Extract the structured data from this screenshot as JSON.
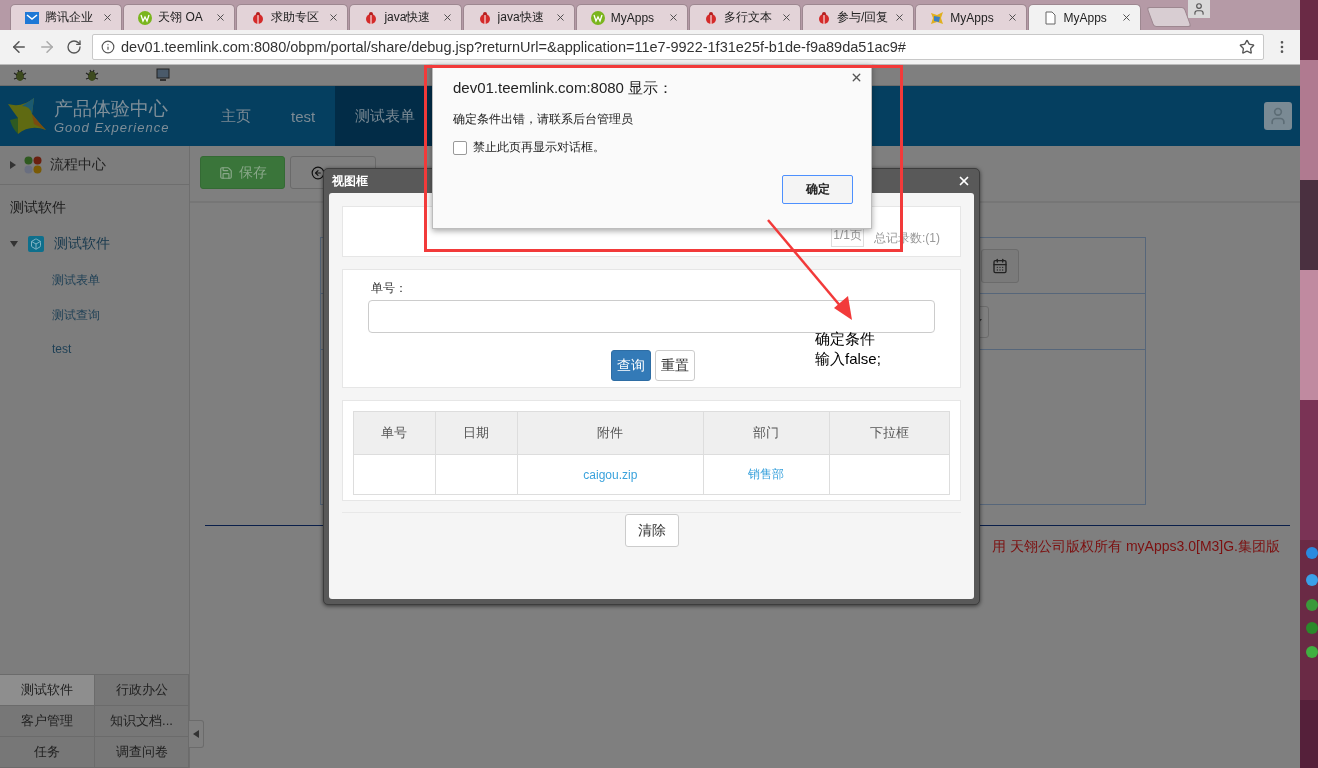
{
  "browser": {
    "tabs": [
      {
        "title": "腾讯企业",
        "kind": "mail",
        "selected": false
      },
      {
        "title": "天翎 OA",
        "kind": "w",
        "selected": false
      },
      {
        "title": "求助专区",
        "kind": "bug",
        "selected": false
      },
      {
        "title": "java快速",
        "kind": "bug",
        "selected": false
      },
      {
        "title": "java快速",
        "kind": "bug",
        "selected": false
      },
      {
        "title": "MyApps",
        "kind": "w",
        "selected": false
      },
      {
        "title": "多行文本",
        "kind": "bug",
        "selected": false
      },
      {
        "title": "参与/回复",
        "kind": "bug",
        "selected": false
      },
      {
        "title": "MyApps",
        "kind": "star",
        "selected": false
      },
      {
        "title": "MyApps",
        "kind": "page",
        "selected": true
      }
    ],
    "url": "dev01.teemlink.com:8080/obpm/portal/share/debug.jsp?returnUrl=&application=11e7-9922-1f31e25f-b1de-f9a89da51ac9#"
  },
  "header": {
    "logo_title": "产品体验中心",
    "logo_subtitle": "Good Experience",
    "nav": [
      {
        "label": "主页",
        "selected": false
      },
      {
        "label": "test",
        "selected": false
      },
      {
        "label": "测试表单",
        "selected": true
      }
    ]
  },
  "sidebar": {
    "group": {
      "label": "流程中心",
      "expanded": false
    },
    "section_title": "测试软件",
    "tree": [
      {
        "label": "测试软件",
        "expanded": true,
        "children": [
          {
            "label": "测试表单"
          },
          {
            "label": "测试查询"
          },
          {
            "label": "test"
          }
        ]
      }
    ],
    "modules": [
      {
        "label": "测试软件",
        "selected": true
      },
      {
        "label": "行政办公",
        "selected": false
      },
      {
        "label": "客户管理",
        "selected": false
      },
      {
        "label": "知识文档...",
        "selected": false
      },
      {
        "label": "任务",
        "selected": false
      },
      {
        "label": "调查问卷",
        "selected": false
      }
    ]
  },
  "toolbar": {
    "save_button": "保存"
  },
  "footer": {
    "copyright": "用 天翎公司版权所有 myApps3.0[M3]G.集团版"
  },
  "view_dialog": {
    "title": "视图框",
    "pager": {
      "page": "1/1页",
      "total": "总记录数:(1)"
    },
    "search": {
      "label": "单号：",
      "buttons": [
        {
          "label": "查询",
          "kind": "primary"
        },
        {
          "label": "重置",
          "kind": "default"
        }
      ]
    },
    "table": {
      "columns": [
        "单号",
        "日期",
        "附件",
        "部门",
        "下拉框"
      ],
      "rows": [
        {
          "cells": [
            null,
            null,
            "caigou.zip",
            "销售部",
            null
          ]
        }
      ]
    },
    "clear_button": "清除"
  },
  "alert": {
    "title": "dev01.teemlink.com:8080 显示：",
    "message": "确定条件出错，请联系后台管理员",
    "checkbox": {
      "label": "禁止此页再显示对话框。",
      "checked": false
    },
    "ok_button": "确定"
  },
  "annotation": {
    "lines": [
      "确定条件",
      "输入false;"
    ]
  }
}
